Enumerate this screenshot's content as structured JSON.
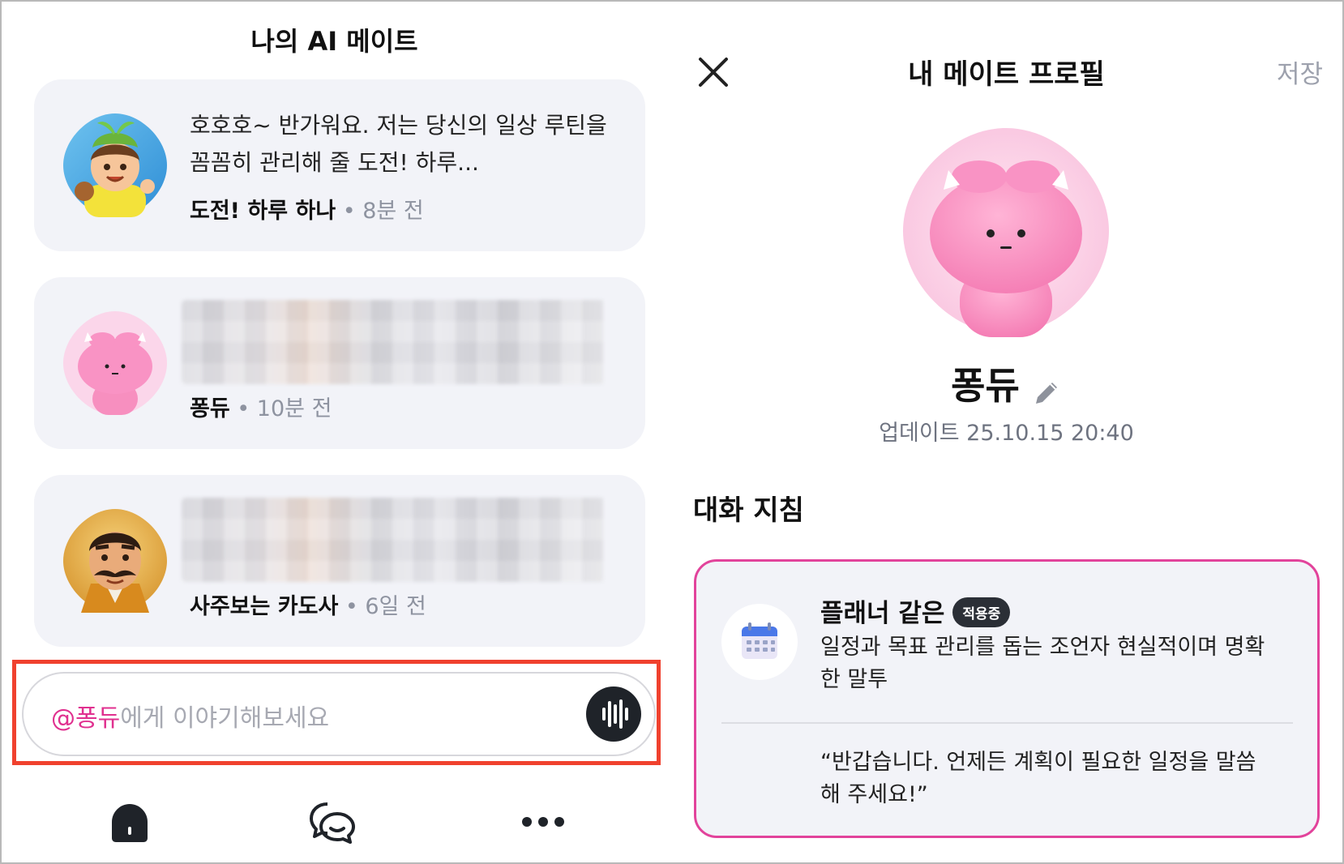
{
  "left": {
    "title": "나의 AI 메이트",
    "chats": [
      {
        "message": "호호호~ 반가워요. 저는 당신의 일상 루틴을 꼼꼼히 관리해 줄 도전! 하루...",
        "name": "도전! 하루 하나",
        "time": "• 8분 전",
        "avatar_icon": "sprout-boy-avatar"
      },
      {
        "message": "",
        "name": "퐁듀",
        "time": "• 10분 전",
        "avatar_icon": "pink-mochi-avatar"
      },
      {
        "message": "",
        "name": "사주보는 카도사",
        "time": "• 6일 전",
        "avatar_icon": "mustache-man-avatar"
      }
    ],
    "input": {
      "mention": "@퐁듀",
      "placeholder": "에게 이야기해보세요",
      "voice_icon": "voice-wave-icon"
    },
    "tabs": [
      "home-icon",
      "chat-icon",
      "more-icon"
    ]
  },
  "right": {
    "title": "내 메이트 프로필",
    "save_label": "저장",
    "name": "퐁듀",
    "updated": "업데이트 25.10.15 20:40",
    "section_title": "대화 지침",
    "guide": {
      "name": "플래너 같은",
      "badge": "적용중",
      "description": "일정과 목표 관리를 돕는 조언자 현실적이며 명확한 말투",
      "quote": "“반갑습니다. 언제든 계획이 필요한 일정을 말씀해 주세요!”"
    }
  },
  "colors": {
    "accent_pink": "#e0308f",
    "highlight_red": "#f0412e",
    "card_bg": "#f2f3f8",
    "badge_bg": "#2b2f36"
  }
}
